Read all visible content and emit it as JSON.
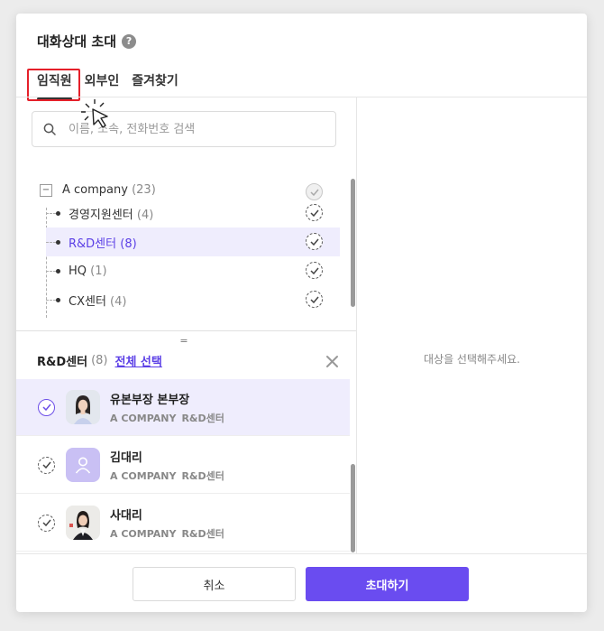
{
  "dialog": {
    "title": "대화상대 초대",
    "help_icon": "question-circle-icon"
  },
  "tabs": [
    {
      "label": "임직원",
      "active": true
    },
    {
      "label": "외부인",
      "active": false
    },
    {
      "label": "즐겨찾기",
      "active": false
    }
  ],
  "search": {
    "placeholder": "이름, 소속, 전화번호 검색",
    "value": ""
  },
  "tree": {
    "root": {
      "name": "A company",
      "count": "(23)"
    },
    "items": [
      {
        "name": "경영지원센터",
        "count": "(4)",
        "selected": false
      },
      {
        "name": "R&D센터",
        "count": "(8)",
        "selected": true
      },
      {
        "name": "HQ",
        "count": "(1)",
        "selected": false
      },
      {
        "name": "CX센터",
        "count": "(4)",
        "selected": false
      }
    ]
  },
  "group": {
    "title": "R&D센터",
    "count": "(8)",
    "select_all": "전체 선택"
  },
  "members": [
    {
      "name": "유본부장 본부장",
      "company": "A COMPANY",
      "dept": "R&D센터",
      "selected": true,
      "avatar": "photo"
    },
    {
      "name": "김대리",
      "company": "A COMPANY",
      "dept": "R&D센터",
      "selected": false,
      "avatar": "default-user-icon"
    },
    {
      "name": "사대리",
      "company": "A COMPANY",
      "dept": "R&D센터",
      "selected": false,
      "avatar": "photo"
    }
  ],
  "right_pane": {
    "empty_message": "대상을 선택해주세요."
  },
  "footer": {
    "cancel_label": "취소",
    "invite_label": "초대하기"
  },
  "colors": {
    "accent": "#6a4cf0",
    "selected_bg": "#efedfd",
    "highlight_border": "#e5202a"
  }
}
